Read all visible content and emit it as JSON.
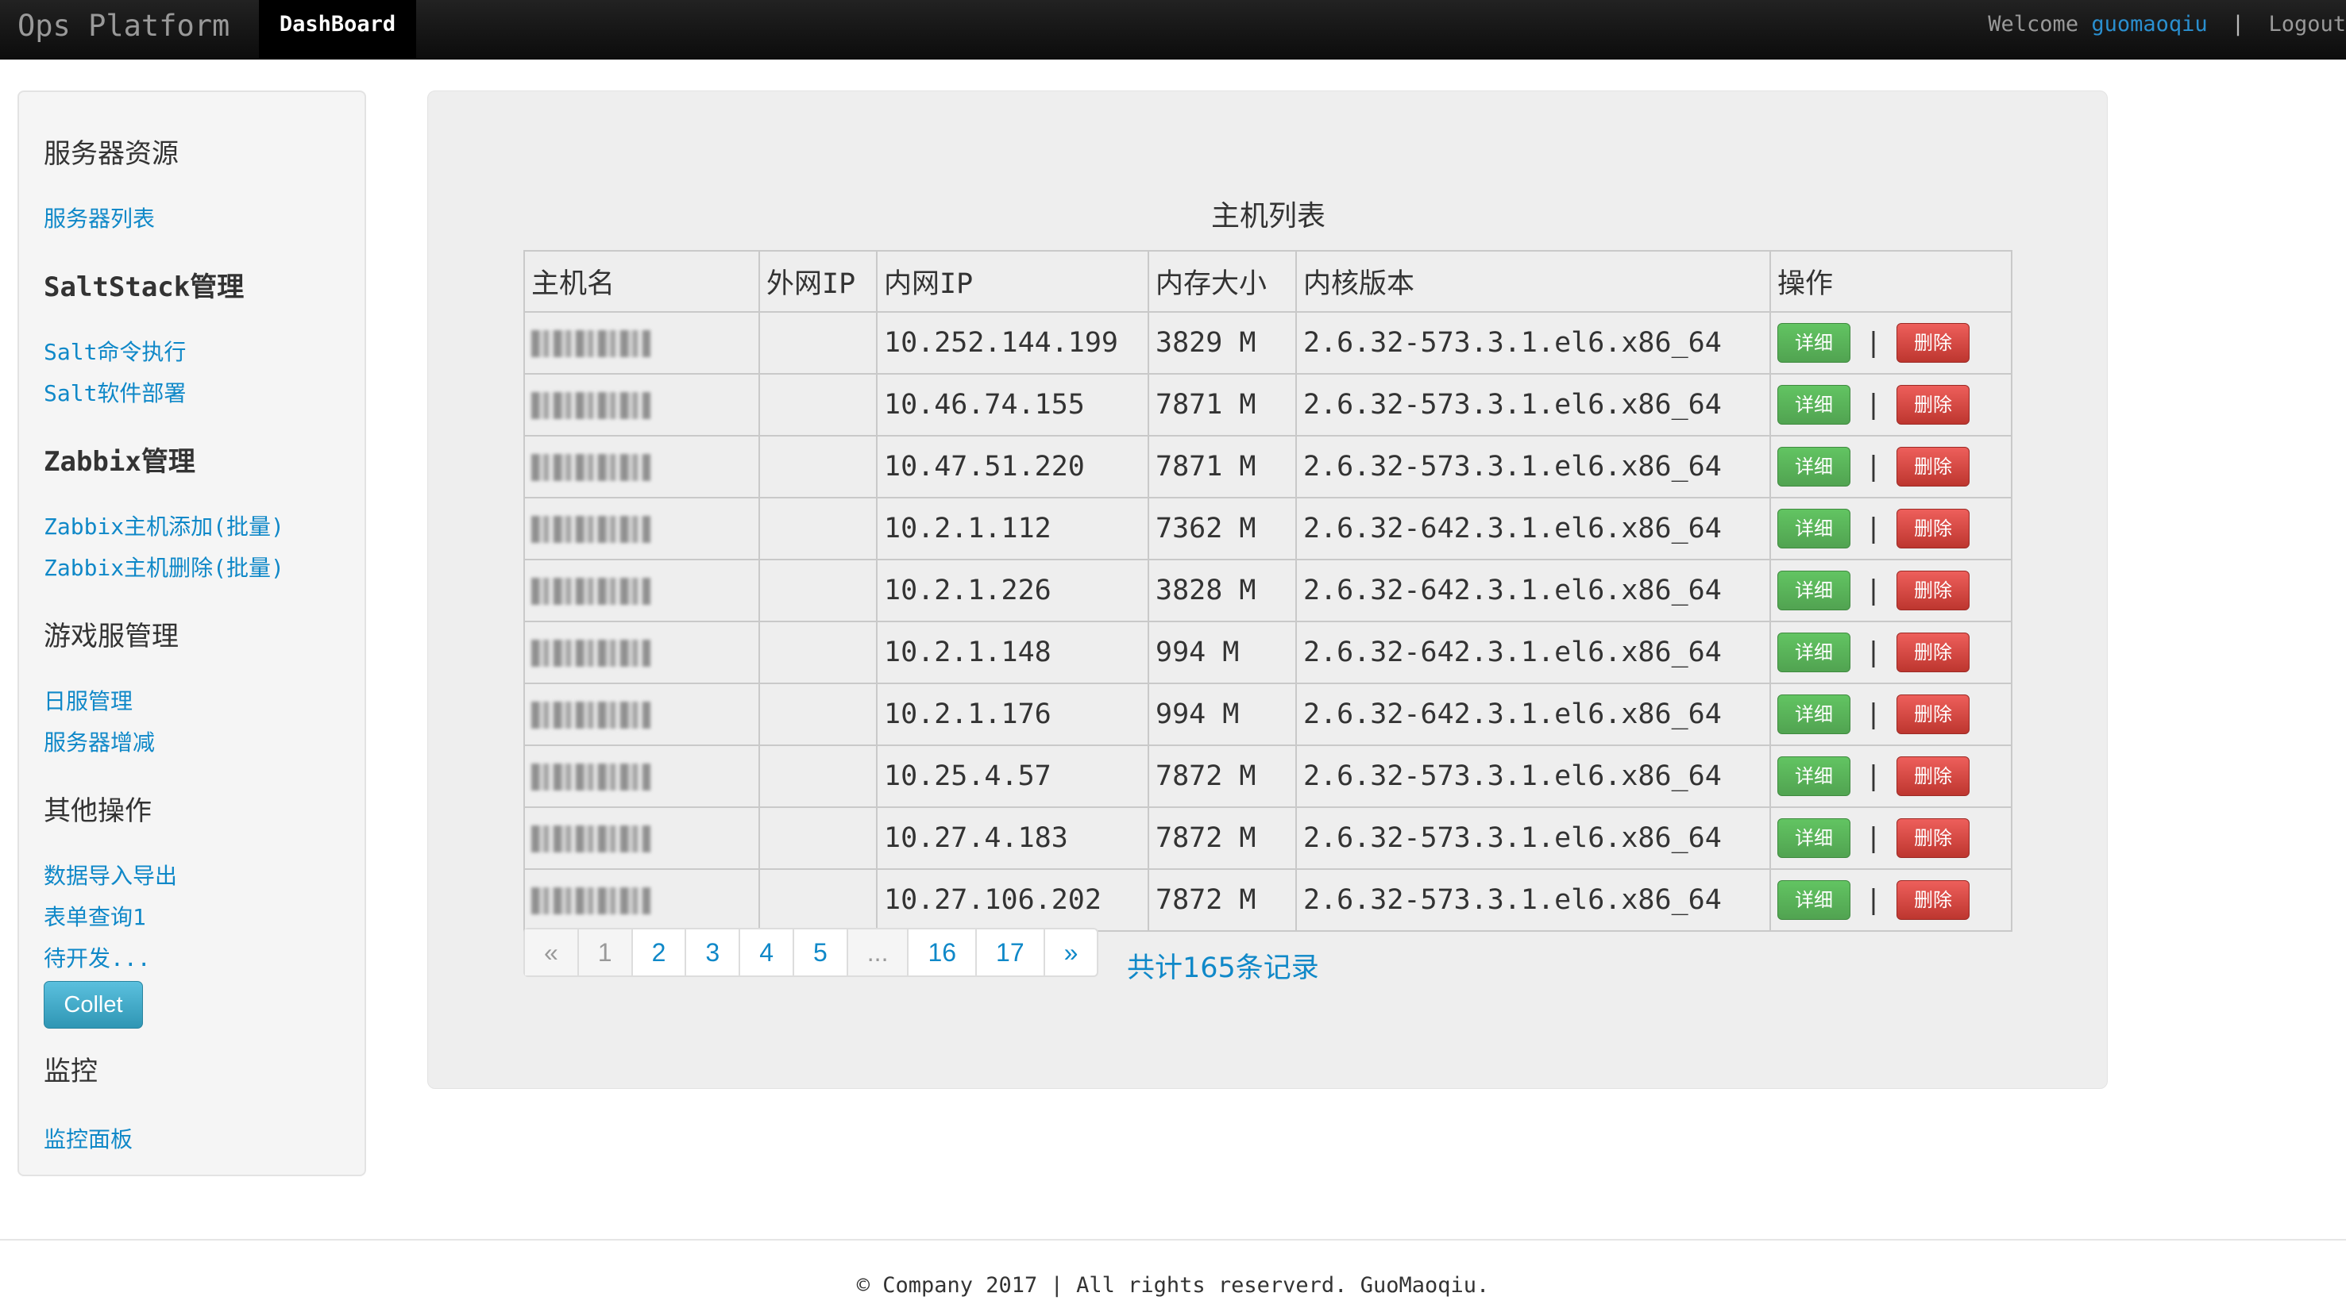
{
  "navbar": {
    "brand": "Ops Platform",
    "active_tab": "DashBoard",
    "welcome": "Welcome",
    "username": "guomaoqiu",
    "separator": "|",
    "logout": "Logout"
  },
  "sidebar": {
    "sections": [
      {
        "heading": "服务器资源",
        "items": [
          "服务器列表"
        ]
      },
      {
        "heading": "SaltStack管理",
        "items": [
          "Salt命令执行",
          "Salt软件部署"
        ]
      },
      {
        "heading": "Zabbix管理",
        "items": [
          "Zabbix主机添加(批量)",
          "Zabbix主机删除(批量)"
        ]
      },
      {
        "heading": "游戏服管理",
        "items": [
          "日服管理",
          "服务器增减"
        ]
      },
      {
        "heading": "其他操作",
        "items": [
          "数据导入导出",
          "表单查询1",
          "待开发..."
        ]
      },
      {
        "heading": "监控",
        "items": [
          "监控面板"
        ]
      }
    ],
    "collet_button": "Collet"
  },
  "main": {
    "table_title": "主机列表",
    "columns": [
      "主机名",
      "外网IP",
      "内网IP",
      "内存大小",
      "内核版本",
      "操作"
    ],
    "rows": [
      {
        "hostname": "",
        "public_ip": "",
        "private_ip": "10.252.144.199",
        "memory": "3829 M",
        "kernel": "2.6.32-573.3.1.el6.x86_64"
      },
      {
        "hostname": "",
        "public_ip": "",
        "private_ip": "10.46.74.155",
        "memory": "7871 M",
        "kernel": "2.6.32-573.3.1.el6.x86_64"
      },
      {
        "hostname": "",
        "public_ip": "",
        "private_ip": "10.47.51.220",
        "memory": "7871 M",
        "kernel": "2.6.32-573.3.1.el6.x86_64"
      },
      {
        "hostname": "",
        "public_ip": "",
        "private_ip": "10.2.1.112",
        "memory": "7362 M",
        "kernel": "2.6.32-642.3.1.el6.x86_64"
      },
      {
        "hostname": "",
        "public_ip": "",
        "private_ip": "10.2.1.226",
        "memory": "3828 M",
        "kernel": "2.6.32-642.3.1.el6.x86_64"
      },
      {
        "hostname": "",
        "public_ip": "",
        "private_ip": "10.2.1.148",
        "memory": "994 M",
        "kernel": "2.6.32-642.3.1.el6.x86_64"
      },
      {
        "hostname": "",
        "public_ip": "",
        "private_ip": "10.2.1.176",
        "memory": "994 M",
        "kernel": "2.6.32-642.3.1.el6.x86_64"
      },
      {
        "hostname": "",
        "public_ip": "",
        "private_ip": "10.25.4.57",
        "memory": "7872 M",
        "kernel": "2.6.32-573.3.1.el6.x86_64"
      },
      {
        "hostname": "",
        "public_ip": "",
        "private_ip": "10.27.4.183",
        "memory": "7872 M",
        "kernel": "2.6.32-573.3.1.el6.x86_64"
      },
      {
        "hostname": "",
        "public_ip": "",
        "private_ip": "10.27.106.202",
        "memory": "7872 M",
        "kernel": "2.6.32-573.3.1.el6.x86_64"
      }
    ],
    "row_actions": {
      "detail": "详细",
      "separator": "|",
      "delete": "删除"
    },
    "pagination": [
      "«",
      "1",
      "2",
      "3",
      "4",
      "5",
      "...",
      "16",
      "17",
      "»"
    ],
    "current_page": "1",
    "record_count": "共计165条记录"
  },
  "footer": {
    "text": "© Company 2017 | All rights reserverd. GuoMaoqiu."
  },
  "colors": {
    "link": "#0f88c8",
    "detail_button": "#51a351",
    "delete_button": "#bd362f",
    "collet_button": "#2f96b4",
    "navbar": "#1b1b1b"
  }
}
